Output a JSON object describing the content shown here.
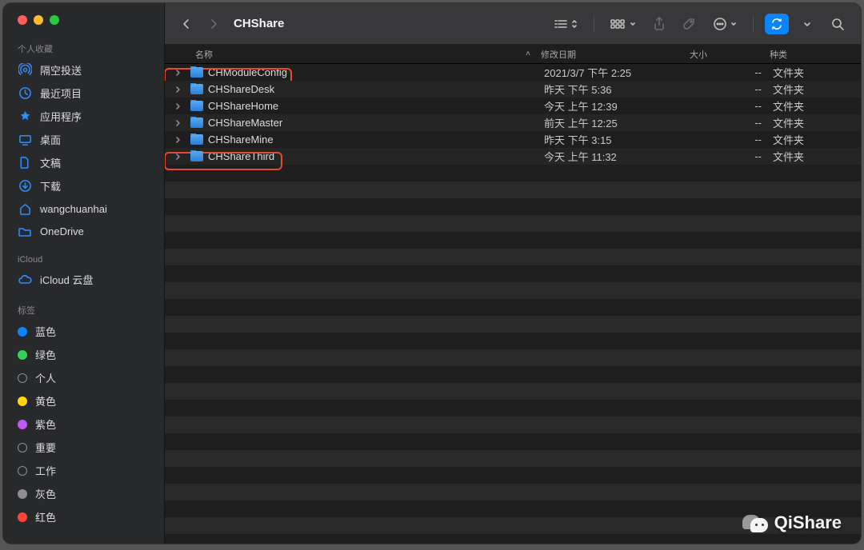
{
  "window": {
    "title": "CHShare"
  },
  "sidebar": {
    "favorites_label": "个人收藏",
    "favorites": [
      {
        "icon": "airdrop-icon",
        "label": "隔空投送"
      },
      {
        "icon": "clock-icon",
        "label": "最近项目"
      },
      {
        "icon": "appstore-icon",
        "label": "应用程序"
      },
      {
        "icon": "desktop-icon",
        "label": "桌面"
      },
      {
        "icon": "doc-icon",
        "label": "文稿"
      },
      {
        "icon": "downloads-icon",
        "label": "下载"
      },
      {
        "icon": "home-icon",
        "label": "wangchuanhai"
      },
      {
        "icon": "cloudfolder-icon",
        "label": "OneDrive"
      }
    ],
    "icloud_label": "iCloud",
    "icloud": [
      {
        "icon": "icloud-icon",
        "label": "iCloud 云盘"
      }
    ],
    "tags_label": "标签",
    "tags": [
      {
        "color": "#0a84ff",
        "filled": true,
        "label": "蓝色"
      },
      {
        "color": "#30d158",
        "filled": true,
        "label": "绿色"
      },
      {
        "color": "transparent",
        "filled": false,
        "label": "个人"
      },
      {
        "color": "#ffd60a",
        "filled": true,
        "label": "黄色"
      },
      {
        "color": "#bf5af2",
        "filled": true,
        "label": "紫色"
      },
      {
        "color": "transparent",
        "filled": false,
        "label": "重要"
      },
      {
        "color": "transparent",
        "filled": false,
        "label": "工作"
      },
      {
        "color": "#8e8e93",
        "filled": true,
        "label": "灰色"
      },
      {
        "color": "#ff453a",
        "filled": true,
        "label": "红色"
      }
    ]
  },
  "columns": {
    "name": "名称",
    "date": "修改日期",
    "size": "大小",
    "kind": "种类"
  },
  "rows": [
    {
      "name": "CHModuleConfig",
      "date": "2021/3/7 下午 2:25",
      "size": "--",
      "kind": "文件夹",
      "highlight": true,
      "hlWidth": 160
    },
    {
      "name": "CHShareDesk",
      "date": "昨天 下午 5:36",
      "size": "--",
      "kind": "文件夹",
      "highlight": false,
      "hlWidth": 0
    },
    {
      "name": "CHShareHome",
      "date": "今天 上午 12:39",
      "size": "--",
      "kind": "文件夹",
      "highlight": false,
      "hlWidth": 0
    },
    {
      "name": "CHShareMaster",
      "date": "前天 上午 12:25",
      "size": "--",
      "kind": "文件夹",
      "highlight": false,
      "hlWidth": 0
    },
    {
      "name": "CHShareMine",
      "date": "昨天 下午 3:15",
      "size": "--",
      "kind": "文件夹",
      "highlight": false,
      "hlWidth": 0
    },
    {
      "name": "CHShareThird",
      "date": "今天 上午 11:32",
      "size": "--",
      "kind": "文件夹",
      "highlight": true,
      "hlWidth": 148
    }
  ],
  "watermark": "QiShare"
}
